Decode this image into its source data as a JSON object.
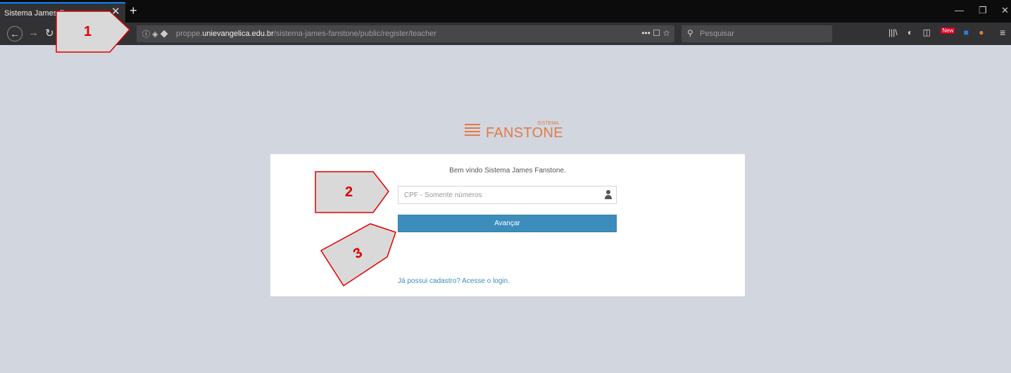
{
  "browser": {
    "tab_title": "Sistema James F",
    "url_prefix": "proppe.",
    "url_domain": "unievangelica.edu.br",
    "url_path": "/sistema-james-fanstone/public/register/teacher",
    "search_placeholder": "Pesquisar",
    "badge_new": "New"
  },
  "logo": {
    "top_text": "SISTEMA",
    "name": "FANSTONE",
    "color": "#e07b4a"
  },
  "form": {
    "welcome": "Bem vindo Sistema James Fanstone.",
    "cpf_placeholder": "CPF - Somente números",
    "next_button": "Avançar",
    "login_link": "Já possui cadastro? Acesse o login."
  },
  "annotations": {
    "step1": "1",
    "step2": "2",
    "step3": "3"
  },
  "colors": {
    "accent": "#3c8dbc",
    "annotation_red": "#e00000",
    "page_bg": "#d2d6de"
  }
}
